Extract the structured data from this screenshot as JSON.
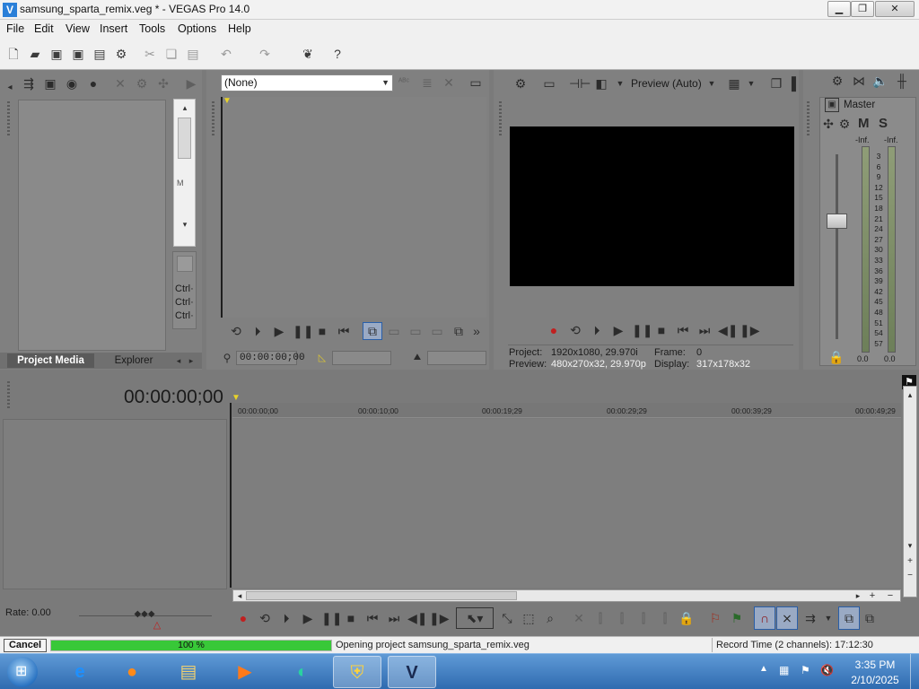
{
  "window": {
    "title": "samsung_sparta_remix.veg * - VEGAS Pro 14.0",
    "app_icon": "vegas-icon",
    "controls": [
      "minimize-icon",
      "restore-icon",
      "close-icon"
    ]
  },
  "menu": [
    "File",
    "Edit",
    "View",
    "Insert",
    "Tools",
    "Options",
    "Help"
  ],
  "project_media": {
    "tabs": [
      "Project Media",
      "Explorer"
    ],
    "active_tab": "Project Media",
    "side_letter": "M",
    "side_lines": [
      "Ctrl·",
      "Ctrl·",
      "Ctrl·"
    ]
  },
  "trimmer": {
    "source_select": "(None)",
    "timecode": "00:00:00;00"
  },
  "preview": {
    "quality": "Preview (Auto)",
    "project_label": "Project:",
    "project_value": "1920x1080, 29.970i",
    "frame_label": "Frame:",
    "frame_value": "0",
    "preview_label": "Preview:",
    "preview_value": "480x270x32, 29.970p",
    "display_label": "Display:",
    "display_value": "317x178x32"
  },
  "master_bus": {
    "title": "Master",
    "mute": "M",
    "solo": "S",
    "peak_left": "-Inf.",
    "peak_right": "-Inf.",
    "scale": [
      "3",
      "6",
      "9",
      "12",
      "15",
      "18",
      "21",
      "24",
      "27",
      "30",
      "33",
      "36",
      "39",
      "42",
      "45",
      "48",
      "51",
      "54",
      "57"
    ],
    "level_left": "0.0",
    "level_right": "0.0"
  },
  "timeline": {
    "cursor_time": "00:00:00;00",
    "ruler_marks": [
      "00:00:00;00",
      "00:00:10;00",
      "00:00:19;29",
      "00:00:29;29",
      "00:00:39;29",
      "00:00:49;29"
    ],
    "rate_label": "Rate: 0.00"
  },
  "status": {
    "cancel": "Cancel",
    "progress_text": "100 %",
    "progress_fraction": 1.0,
    "message": "Opening project samsung_sparta_remix.veg",
    "record_time": "Record Time (2 channels): 17:12:30"
  },
  "taskbar": {
    "apps": [
      "internet-explorer-icon",
      "firefox-icon",
      "file-explorer-icon",
      "media-player-icon",
      "media-center-icon",
      "security-shield-icon",
      "vegas-icon"
    ],
    "clock_time": "3:35 PM",
    "clock_date": "2/10/2025"
  },
  "colors": {
    "panel_bg": "#808080",
    "preview_screen": "#000000",
    "progress_fill": "#38c838",
    "taskbar_top": "#5f9ad6"
  }
}
